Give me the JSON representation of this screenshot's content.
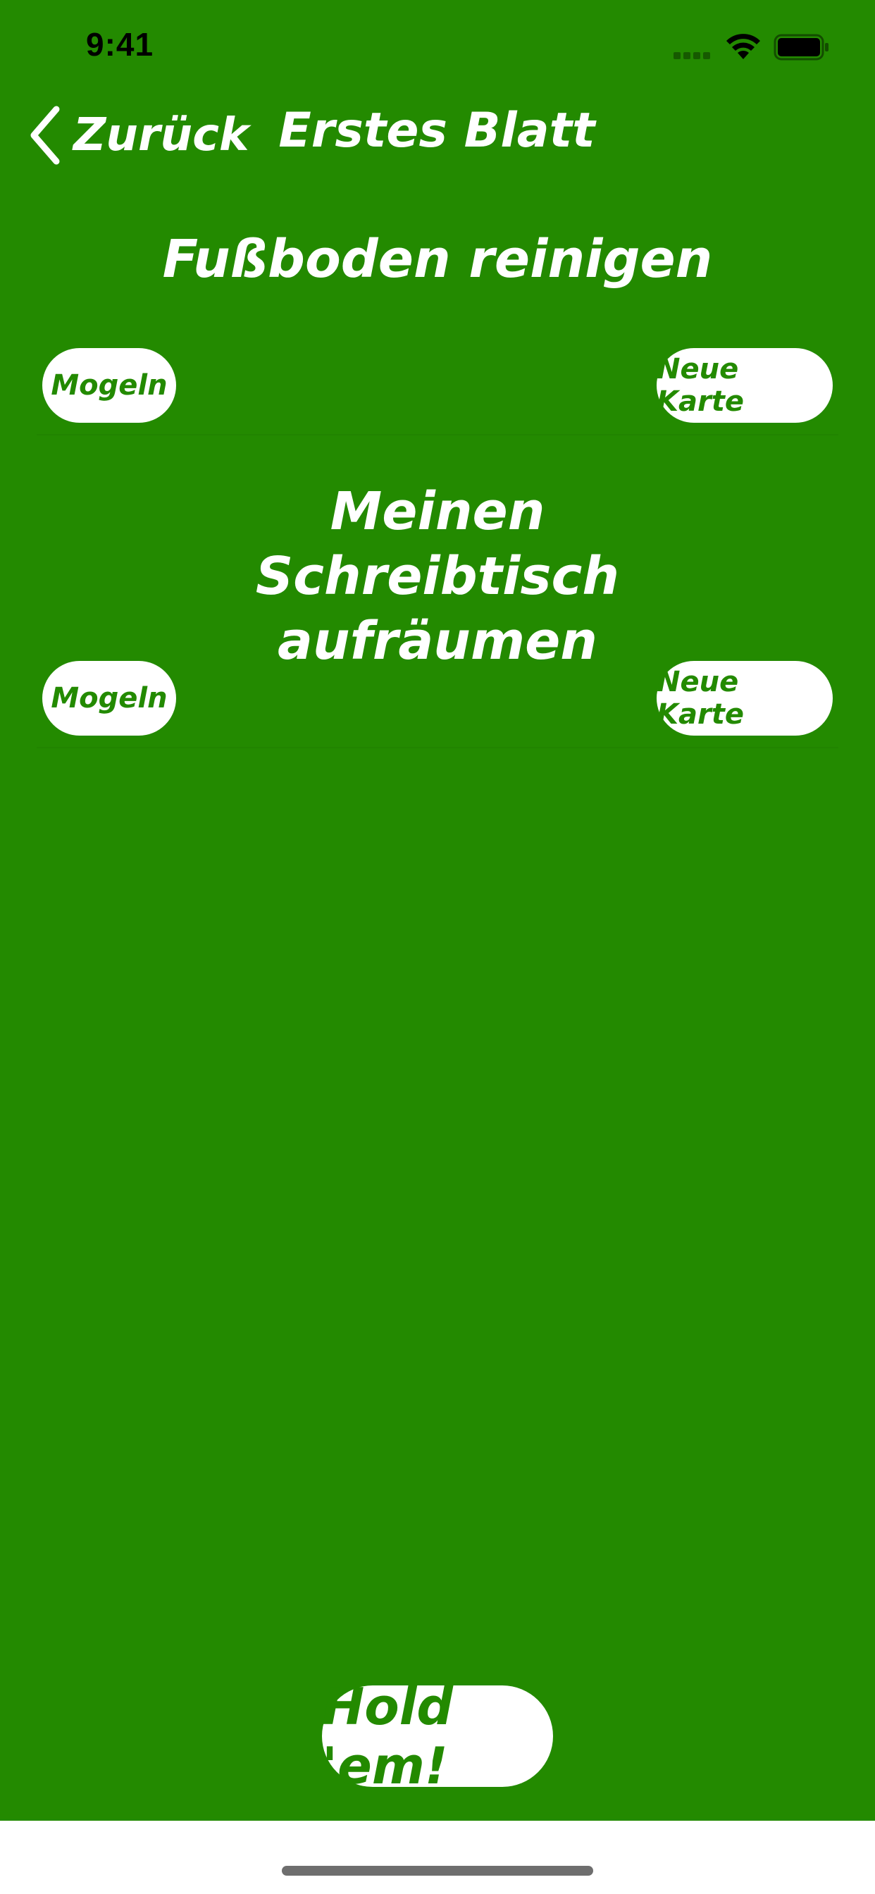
{
  "status_bar": {
    "time": "9:41"
  },
  "nav": {
    "back_label": "Zurück",
    "title": "Erstes Blatt"
  },
  "tasks": [
    {
      "title": "Fußboden reinigen",
      "cheat_label": "Mogeln",
      "new_card_label": "Neue Karte"
    },
    {
      "title": "Meinen Schreibtisch aufräumen",
      "cheat_label": "Mogeln",
      "new_card_label": "Neue Karte"
    }
  ],
  "hold_button_label": "Hold 'em!",
  "colors": {
    "background": "#238a00",
    "button_background": "#ffffff",
    "button_text": "#238a00",
    "text": "#ffffff"
  },
  "icons": {
    "back": "chevron-left-icon",
    "wifi": "wifi-icon",
    "battery": "battery-icon",
    "signal": "cellular-signal-icon"
  }
}
